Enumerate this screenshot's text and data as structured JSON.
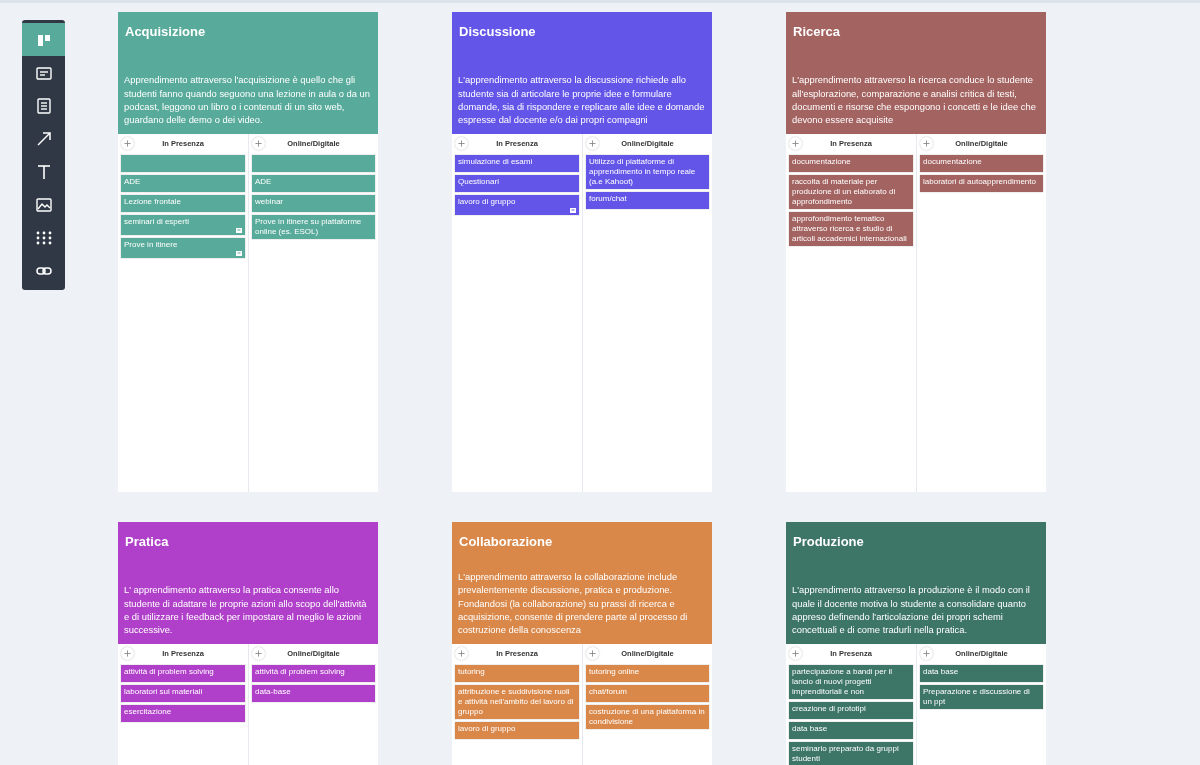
{
  "toolbar": [
    {
      "kind": "layout",
      "selected": true
    },
    {
      "kind": "card",
      "selected": false
    },
    {
      "kind": "document",
      "selected": false
    },
    {
      "kind": "arrow",
      "selected": false
    },
    {
      "kind": "text",
      "selected": false
    },
    {
      "kind": "image",
      "selected": false
    },
    {
      "kind": "grid",
      "selected": false
    },
    {
      "kind": "link",
      "selected": false
    }
  ],
  "cards": [
    {
      "title": "Acquisizione",
      "color": "#58ab9b",
      "description": "Apprendimento attraverso l'acquisizione è quello che gli studenti fanno quando seguono una lezione in aula o da un podcast, leggono un libro o i contenuti di un sito web, guardano delle demo o dei video.",
      "columns": [
        {
          "label": "In Presenza",
          "notes": [
            {
              "comment": false
            },
            {
              "text": "ADE",
              "comment": false
            },
            {
              "text": "Lezione frontale",
              "comment": false
            },
            {
              "text": "seminari di esperti",
              "comment": true
            },
            {
              "text": "Prove in itinere",
              "comment": true
            }
          ]
        },
        {
          "label": "Online/Digitale",
          "notes": [
            {
              "comment": false
            },
            {
              "text": "ADE",
              "comment": false
            },
            {
              "text": "webinar",
              "comment": false
            },
            {
              "text": "Prove in itinere su piattaforme online (es. ESOL)",
              "comment": false
            }
          ]
        }
      ]
    },
    {
      "title": "Discussione",
      "color": "#6255e8",
      "description": "L'apprendimento attraverso la discussione richiede allo studente sia di articolare le proprie idee e formulare domande, sia di rispondere e replicare alle idee e domande espresse dal docente e/o dai propri compagni",
      "columns": [
        {
          "label": "In Presenza",
          "notes": [
            {
              "text": "simulazione di esami",
              "comment": false
            },
            {
              "text": "Questionari",
              "comment": false
            },
            {
              "text": "lavoro di gruppo",
              "comment": true
            }
          ]
        },
        {
          "label": "Online/Digitale",
          "notes": [
            {
              "text": "Utilizzo di piattaforme di apprendimento in tempo reale (a.e Kahoot)",
              "comment": false
            },
            {
              "text": "forum/chat",
              "comment": false
            }
          ]
        }
      ]
    },
    {
      "title": "Ricerca",
      "color": "#a36361",
      "description": "L'apprendimento attraverso la ricerca conduce lo studente all'esplorazione, comparazione e analisi critica di testi, documenti e risorse che espongono i concetti e le idee che devono essere acquisite",
      "columns": [
        {
          "label": "In Presenza",
          "notes": [
            {
              "text": "documentazione",
              "comment": false
            },
            {
              "text": "raccolta di materiale per produzione di un elaborato di approfondimento",
              "comment": false
            },
            {
              "text": "approfondimento tematico attraverso ricerca e studio di articoli accademici internazionali",
              "comment": false
            }
          ]
        },
        {
          "label": "Online/Digitale",
          "notes": [
            {
              "text": "documentazione",
              "comment": false
            },
            {
              "text": "laboratori di autoapprendimento",
              "comment": false
            }
          ]
        }
      ]
    },
    {
      "title": "Pratica",
      "color": "#b040c9",
      "description": "L' apprendimento attraverso la pratica consente allo studente di adattare le proprie azioni allo scopo dell'attività e di utilizzare i feedback per impostare al meglio le azioni successive.",
      "columns": [
        {
          "label": "In Presenza",
          "notes": [
            {
              "text": "attività di problem solving",
              "comment": false
            },
            {
              "text": "laboratori sui materiali",
              "comment": false
            },
            {
              "text": "esercitazione",
              "comment": false
            }
          ]
        },
        {
          "label": "Online/Digitale",
          "notes": [
            {
              "text": "attività di problem solving",
              "comment": false
            },
            {
              "text": "data-base",
              "comment": false
            }
          ]
        }
      ]
    },
    {
      "title": "Collaborazione",
      "color": "#d9884a",
      "description": "L'apprendimento attraverso la collaborazione include prevalentemente discussione, pratica e produzione. Fondandosi (la collaborazione) su prassi di ricerca e acquisizione, consente di prendere parte al processo di costruzione della conoscenza",
      "columns": [
        {
          "label": "In Presenza",
          "notes": [
            {
              "text": "tutoring",
              "comment": false
            },
            {
              "text": "attribuzione e suddivisione ruoli e attività nell'ambito del lavoro di gruppo",
              "comment": false
            },
            {
              "text": "lavoro di gruppo",
              "comment": false
            }
          ]
        },
        {
          "label": "Online/Digitale",
          "notes": [
            {
              "text": "tutoring online",
              "comment": false
            },
            {
              "text": "chat/forum",
              "comment": false
            },
            {
              "text": "costruzione di una piattaforma in condivisione",
              "comment": false
            }
          ]
        }
      ]
    },
    {
      "title": "Produzione",
      "color": "#3d7566",
      "description": "L'apprendimento attraverso la produzione è il modo con il quale il docente motiva lo studente a consolidare quanto appreso definendo l'articolazione dei propri schemi concettuali e di come tradurli nella pratica.",
      "columns": [
        {
          "label": "In Presenza",
          "notes": [
            {
              "text": "partecipazione a bandi per il lancio di nuovi progetti imprenditoriali e non",
              "comment": false
            },
            {
              "text": "creazione di prototipi",
              "comment": false
            },
            {
              "text": "data base",
              "comment": false
            },
            {
              "text": "seminario preparato da gruppi studenti",
              "comment": false
            }
          ]
        },
        {
          "label": "Online/Digitale",
          "notes": [
            {
              "text": "data base",
              "comment": false
            },
            {
              "text": "Preparazione e discussione di un ppt",
              "comment": false
            }
          ]
        }
      ]
    }
  ]
}
